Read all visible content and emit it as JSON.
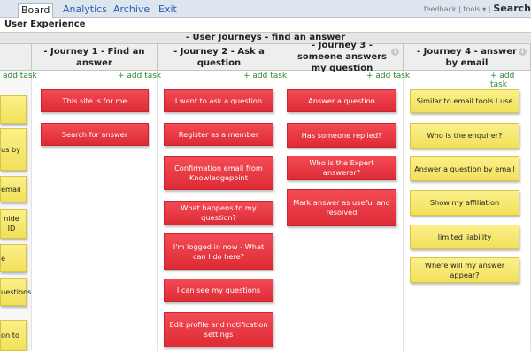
{
  "nav": {
    "tabs": [
      "Board",
      "Analytics",
      "Archive",
      "Exit"
    ],
    "right_links": "feedback | tools ▾ |",
    "search_label": "Search"
  },
  "board": {
    "title": "User Experience",
    "group_title": "- User Journeys - find an answer"
  },
  "columns": [
    "- Journey 1 - Find an answer",
    "- Journey 2 - Ask a question",
    "- Journey 3 - someone answers my question",
    "- Journey 4 - answer by email"
  ],
  "add_task_label": "+ add task",
  "left_column": {
    "add_task_label": "add task",
    "cards": [
      "",
      "us by",
      "email",
      "nide ID",
      "e",
      "uestions",
      "on to"
    ]
  },
  "journey1": {
    "cards": [
      "This site is for me",
      "Search for answer"
    ]
  },
  "journey2": {
    "cards": [
      "I want to ask a question",
      "Register as a member",
      "Confirmation email from Knowledgepoint",
      "What happens to my question?",
      "I'm logged in now - What can I do here?",
      "I can see my questions",
      "Edit profile and notification settings"
    ]
  },
  "journey3": {
    "cards": [
      "Answer a question",
      "Has someone replied?",
      "Who is the Expert answerer?",
      "Mark answer as useful and resolved"
    ]
  },
  "journey4": {
    "cards": [
      "Similar to email tools I use",
      "Who is the enquirer?",
      "Answer a question by email",
      "Show my affiliation",
      "limited liability",
      "Where will my answer appear?"
    ]
  },
  "colors": {
    "red_card": "#e83640",
    "yellow_card": "#f7e96c",
    "link": "#2a5db0",
    "add_task": "#2d8a2d"
  }
}
